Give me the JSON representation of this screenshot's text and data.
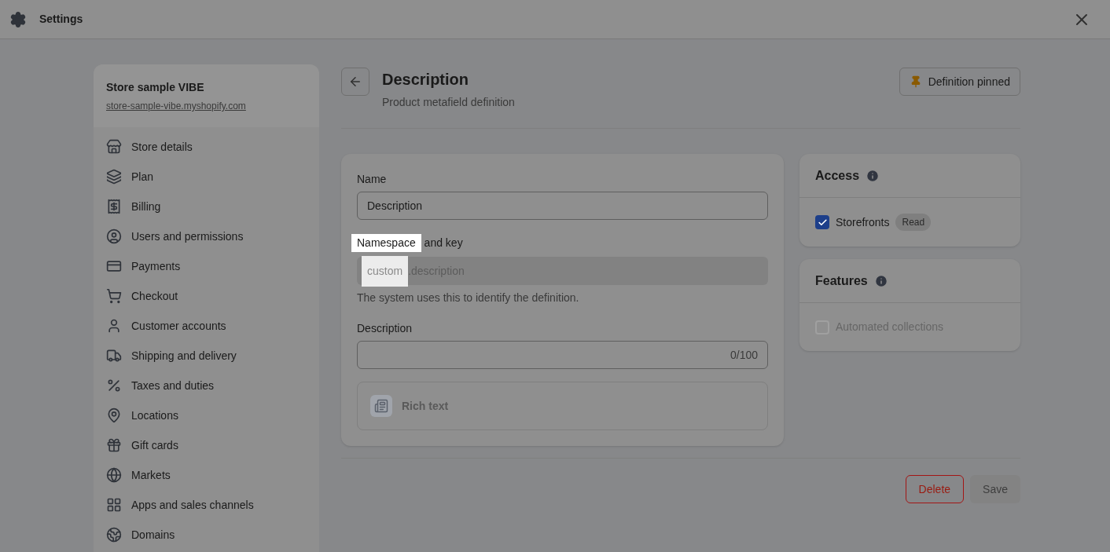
{
  "window": {
    "title": "Settings"
  },
  "store": {
    "name": "Store sample VIBE",
    "domain": "store-sample-vibe.myshopify.com"
  },
  "sidebar": {
    "items": [
      {
        "label": "Store details"
      },
      {
        "label": "Plan"
      },
      {
        "label": "Billing"
      },
      {
        "label": "Users and permissions"
      },
      {
        "label": "Payments"
      },
      {
        "label": "Checkout"
      },
      {
        "label": "Customer accounts"
      },
      {
        "label": "Shipping and delivery"
      },
      {
        "label": "Taxes and duties"
      },
      {
        "label": "Locations"
      },
      {
        "label": "Gift cards"
      },
      {
        "label": "Markets"
      },
      {
        "label": "Apps and sales channels"
      },
      {
        "label": "Domains"
      }
    ]
  },
  "header": {
    "title": "Description",
    "subtitle": "Product metafield definition",
    "pin_button": "Definition pinned"
  },
  "form": {
    "name_label": "Name",
    "name_value": "Description",
    "key_label": [
      {
        "text": "Namespace",
        "highlighted": true
      },
      {
        "text": " and key",
        "highlighted": false
      }
    ],
    "key_value": [
      {
        "text": "custom",
        "highlighted": true
      },
      {
        "text": ".description",
        "highlighted": false
      }
    ],
    "key_help": "The system uses this to identify the definition.",
    "description_label": "Description",
    "description_counter": "0/100",
    "type": "Rich text"
  },
  "access": {
    "title": "Access",
    "items": [
      {
        "label": "Storefronts",
        "checked": true,
        "disabled": false,
        "badge": "Read"
      }
    ]
  },
  "features": {
    "title": "Features",
    "items": [
      {
        "label": "Automated collections",
        "checked": false,
        "disabled": true
      }
    ]
  },
  "buttons": {
    "delete": "Delete",
    "save": "Save",
    "save_disabled": true
  }
}
